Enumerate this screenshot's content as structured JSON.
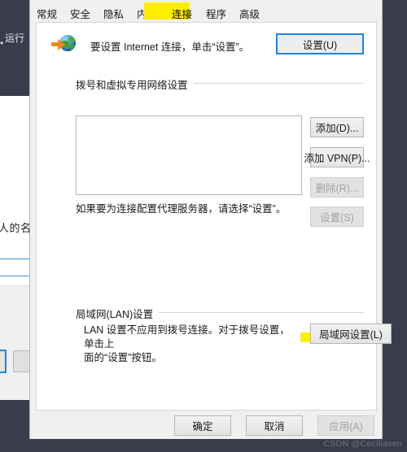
{
  "window": {
    "title_bar_fragment": "运行"
  },
  "background_window": {
    "text_fragment_1": "人的名",
    "text_fragment_2": "。"
  },
  "tabs": [
    {
      "label": "常规",
      "selected": false
    },
    {
      "label": "安全",
      "selected": false
    },
    {
      "label": "隐私",
      "selected": false
    },
    {
      "label": "内容",
      "selected": false
    },
    {
      "label": "连接",
      "selected": true,
      "highlighted": true
    },
    {
      "label": "程序",
      "selected": false
    },
    {
      "label": "高级",
      "selected": false
    }
  ],
  "intro": {
    "text": "要设置 Internet 连接，单击“设置”。",
    "icon": "globe-with-arrow-icon",
    "button_label": "设置(U)"
  },
  "dialup_group": {
    "label": "拨号和虚拟专用网络设置",
    "list_items": [],
    "buttons": [
      {
        "label": "添加(D)...",
        "disabled": false
      },
      {
        "label": "添加 VPN(P)...",
        "disabled": false
      },
      {
        "label": "删除(R)...",
        "disabled": true
      }
    ],
    "note": "如果要为连接配置代理服务器，请选择“设置”。",
    "settings_button": {
      "label": "设置(S)",
      "disabled": true
    }
  },
  "lan_group": {
    "label": "局域网(LAN)设置",
    "note_line_1": "LAN 设置不应用到拨号连接。对于拨号设置，单击上",
    "note_line_2": "面的“设置”按钮。",
    "button_label": "局域网设置(L)",
    "highlighted": true
  },
  "footer": {
    "ok_label": "确定",
    "cancel_label": "取消",
    "apply_label": "应用(A)",
    "apply_disabled": true
  },
  "watermark": {
    "text": "CSDN @Ceciliasen"
  },
  "colors": {
    "highlight": "#ffed00",
    "focus_border": "#1e84e0",
    "desktop": "#383c4d",
    "dialog_face": "#f0f0f0"
  }
}
